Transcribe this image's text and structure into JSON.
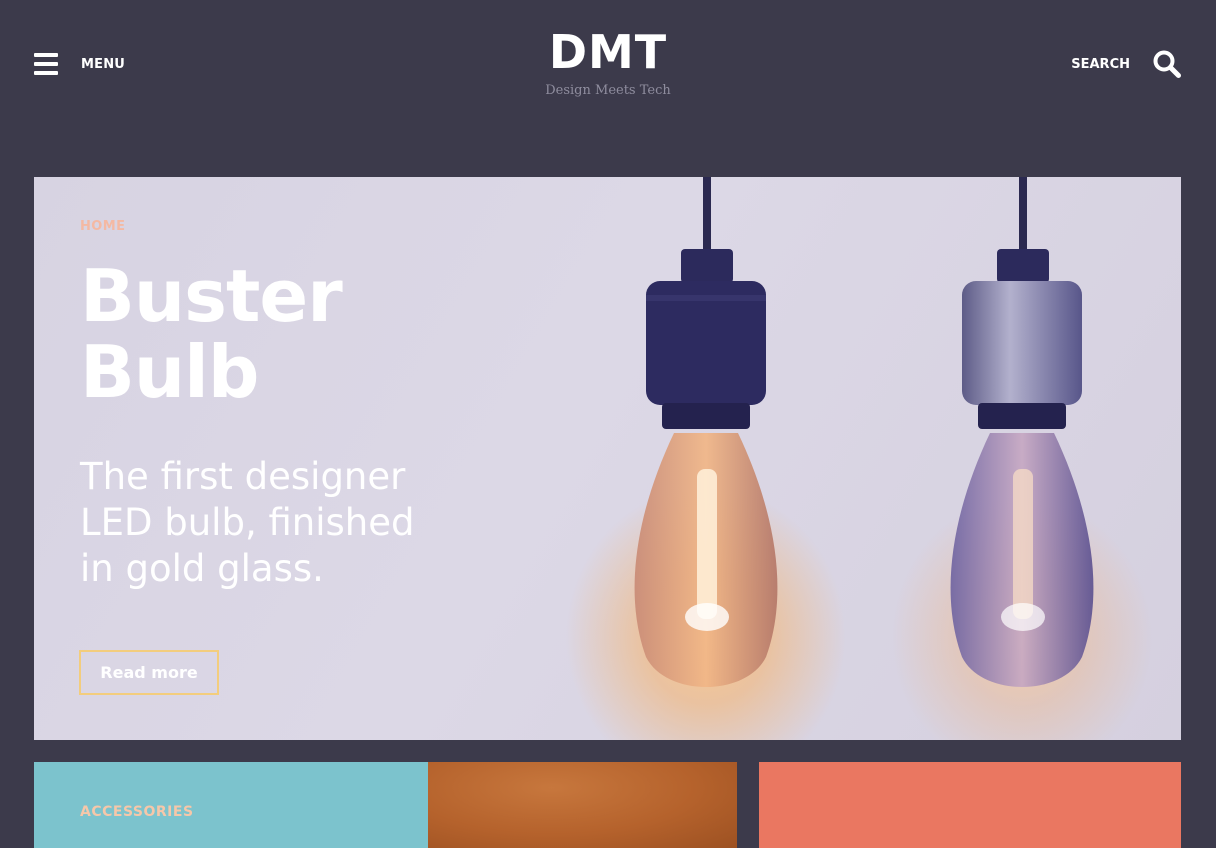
{
  "header": {
    "menu_label": "MENU",
    "logo": "DMT",
    "tagline": "Design Meets Tech",
    "search_label": "SEARCH"
  },
  "hero": {
    "category": "HOME",
    "title_line1": "Buster",
    "title_line2": "Bulb",
    "description_line1": "The first designer",
    "description_line2": "LED bulb, finished",
    "description_line3": "in gold glass.",
    "button_label": "Read more"
  },
  "cards": [
    {
      "category": "ACCESSORIES",
      "color": "#7cc3cd"
    },
    {
      "category": "",
      "color": "#ea7761"
    }
  ],
  "colors": {
    "background": "#3c3a4b",
    "hero_bg": "#d8d4e3",
    "accent_peach": "#f4b9a3",
    "button_border": "#f3cd7d",
    "bulb_socket": "#2c2a5c",
    "bulb_glow": "#f7b36a"
  },
  "icons": {
    "menu": "hamburger-icon",
    "search": "magnifier-icon"
  }
}
